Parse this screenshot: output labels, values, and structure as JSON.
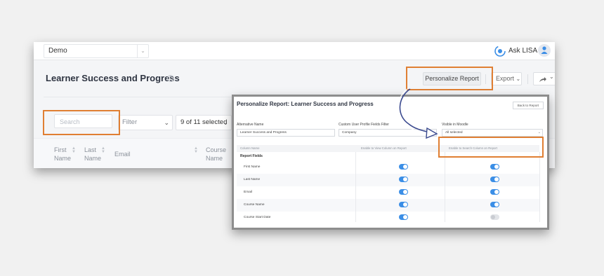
{
  "app": {
    "org_select": "Demo",
    "assistant_label": "Ask LISA",
    "page_title": "Learner Success and Progress",
    "buttons": {
      "personalize": "Personalize Report",
      "export": "Export"
    },
    "search": {
      "placeholder": "Search"
    },
    "filter": {
      "value": "Filter"
    },
    "column_select": {
      "value": "9 of 11 selected"
    },
    "table": {
      "headers": [
        {
          "line1": "First",
          "line2": "Name"
        },
        {
          "line1": "Last",
          "line2": "Name"
        },
        {
          "line1": "Email",
          "line2": ""
        },
        {
          "line1": "Course",
          "line2": "Name"
        }
      ]
    }
  },
  "personalize": {
    "title": "Personalize Report: Learner Success and Progress",
    "back_button": "Back to Report",
    "fields": {
      "alt_name": {
        "label": "Alternative Name",
        "value": "Learner Success and Progress"
      },
      "profile_filter": {
        "label": "Custom User Profile Fields Filter",
        "value": "Company"
      },
      "visible_in": {
        "label": "Visible in Moodle",
        "value": "All selected"
      }
    },
    "columns_header": {
      "name": "Column Name",
      "view": "Enable to View Column on Report",
      "search": "Enable to Search Column on Report"
    },
    "section_label": "Report Fields",
    "rows": [
      {
        "name": "First Name",
        "view_enabled": true,
        "search_enabled": true
      },
      {
        "name": "Last Name",
        "view_enabled": true,
        "search_enabled": true
      },
      {
        "name": "Email",
        "view_enabled": true,
        "search_enabled": true
      },
      {
        "name": "Course Name",
        "view_enabled": true,
        "search_enabled": true
      },
      {
        "name": "Course Start Date",
        "view_enabled": true,
        "search_enabled": false
      }
    ]
  },
  "colors": {
    "highlight": "#e07f33",
    "toggle_on": "#3b8ee6",
    "toggle_off": "#e2e4e8",
    "arrow": "#3b4a8f"
  }
}
